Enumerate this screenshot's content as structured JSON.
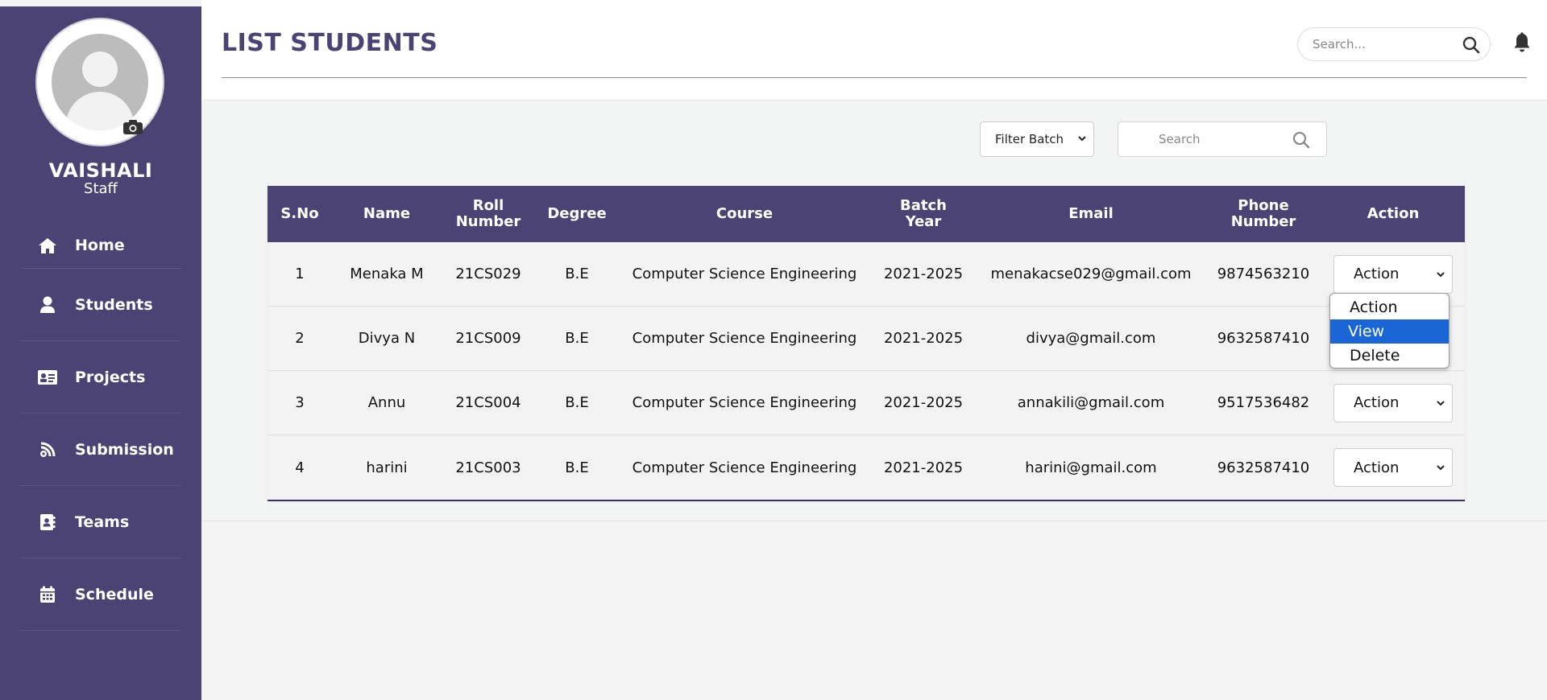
{
  "profile": {
    "name": "VAISHALI",
    "role": "Staff"
  },
  "sidebar": {
    "items": [
      {
        "label": "Home",
        "icon": "home-icon"
      },
      {
        "label": "Students",
        "icon": "user-icon"
      },
      {
        "label": "Projects",
        "icon": "id-card-icon"
      },
      {
        "label": "Submission",
        "icon": "submission-icon"
      },
      {
        "label": "Teams",
        "icon": "contact-book-icon"
      },
      {
        "label": "Schedule",
        "icon": "calendar-icon"
      }
    ]
  },
  "header": {
    "title": "LIST STUDENTS",
    "search_placeholder": "Search..."
  },
  "filters": {
    "batch_label": "Filter Batch",
    "search_placeholder": "Search"
  },
  "table": {
    "columns": [
      "S.No",
      "Name",
      "Roll Number",
      "Degree",
      "Course",
      "Batch Year",
      "Email",
      "Phone Number",
      "Action"
    ],
    "rows": [
      {
        "sno": "1",
        "name": "Menaka M",
        "roll": "21CS029",
        "degree": "B.E",
        "course": "Computer Science Engineering",
        "batch": "2021-2025",
        "email": "menakacse029@gmail.com",
        "phone": "9874563210",
        "action": "Action"
      },
      {
        "sno": "2",
        "name": "Divya N",
        "roll": "21CS009",
        "degree": "B.E",
        "course": "Computer Science Engineering",
        "batch": "2021-2025",
        "email": "divya@gmail.com",
        "phone": "9632587410",
        "action": "Action"
      },
      {
        "sno": "3",
        "name": "Annu",
        "roll": "21CS004",
        "degree": "B.E",
        "course": "Computer Science Engineering",
        "batch": "2021-2025",
        "email": "annakili@gmail.com",
        "phone": "9517536482",
        "action": "Action"
      },
      {
        "sno": "4",
        "name": "harini",
        "roll": "21CS003",
        "degree": "B.E",
        "course": "Computer Science Engineering",
        "batch": "2021-2025",
        "email": "harini@gmail.com",
        "phone": "9632587410",
        "action": "Action"
      }
    ]
  },
  "action_dropdown": {
    "options": [
      "Action",
      "View",
      "Delete"
    ],
    "highlighted": "View"
  },
  "colors": {
    "brand": "#4b4374",
    "highlight": "#1a66d6",
    "panel": "#f2f5f3"
  }
}
